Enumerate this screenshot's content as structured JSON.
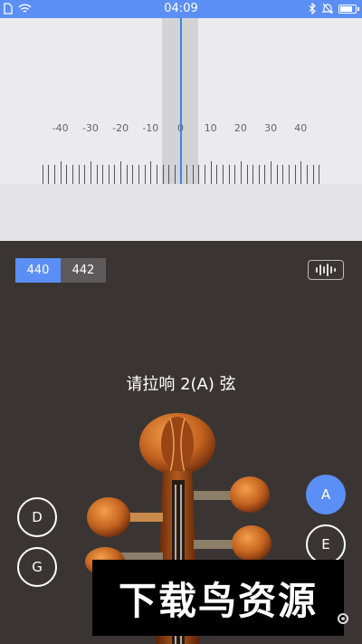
{
  "status_bar": {
    "time": "04:09",
    "battery_level": 0.85,
    "icons_left": [
      "sim-icon",
      "wifi-icon"
    ],
    "icons_right": [
      "bluetooth-icon",
      "mute-icon",
      "battery-icon"
    ]
  },
  "meter": {
    "scale_labels": [
      "-40",
      "-30",
      "-20",
      "-10",
      "0",
      "10",
      "20",
      "30",
      "40"
    ],
    "needle_value": 0,
    "colors": {
      "needle": "#3a86e8",
      "accent": "#5b8ff5"
    }
  },
  "reference_pitch": {
    "options": [
      "440",
      "442"
    ],
    "selected": "440"
  },
  "waveform_button": {
    "icon": "waveform-icon"
  },
  "instruction": "请拉响 2(A) 弦",
  "strings": {
    "d": "D",
    "g": "G",
    "a": "A",
    "e": "E",
    "selected": "A"
  },
  "watermark": "下载鸟资源",
  "settings_icon": "gear-icon"
}
